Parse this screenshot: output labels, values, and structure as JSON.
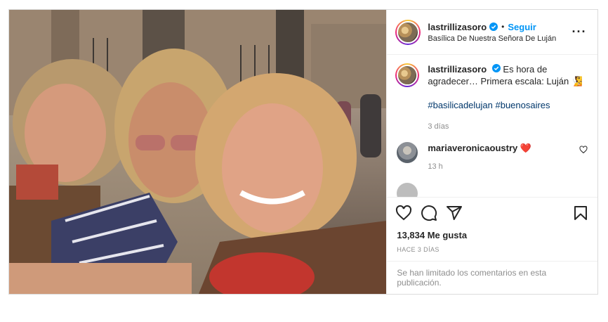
{
  "post": {
    "username": "lastrillizasoro",
    "follow_label": "Seguir",
    "location": "Basílica De Nuestra Señora De Luján",
    "caption": {
      "text": "Es hora de agradecer… Primera escala: Luján",
      "emoji": "🧏",
      "hashtags": "#basilicadelujan #buenosaires",
      "time": "3 días"
    },
    "comments": [
      {
        "username": "mariaveronicaoustry",
        "emoji": "❤️",
        "time": "13 h"
      }
    ],
    "likes": "13,834 Me gusta",
    "ago": "HACE 3 DÍAS",
    "comments_limited": "Se han limitado los comentarios en esta publicación."
  },
  "icons": {
    "verified": "verified-badge-icon",
    "more": "more-options-icon",
    "like": "heart-icon",
    "comment": "comment-icon",
    "share": "share-icon",
    "save": "bookmark-icon"
  },
  "colors": {
    "follow": "#0095f6",
    "hashtag": "#00376b",
    "heart": "#ed4956",
    "muted": "#8e8e8e"
  }
}
